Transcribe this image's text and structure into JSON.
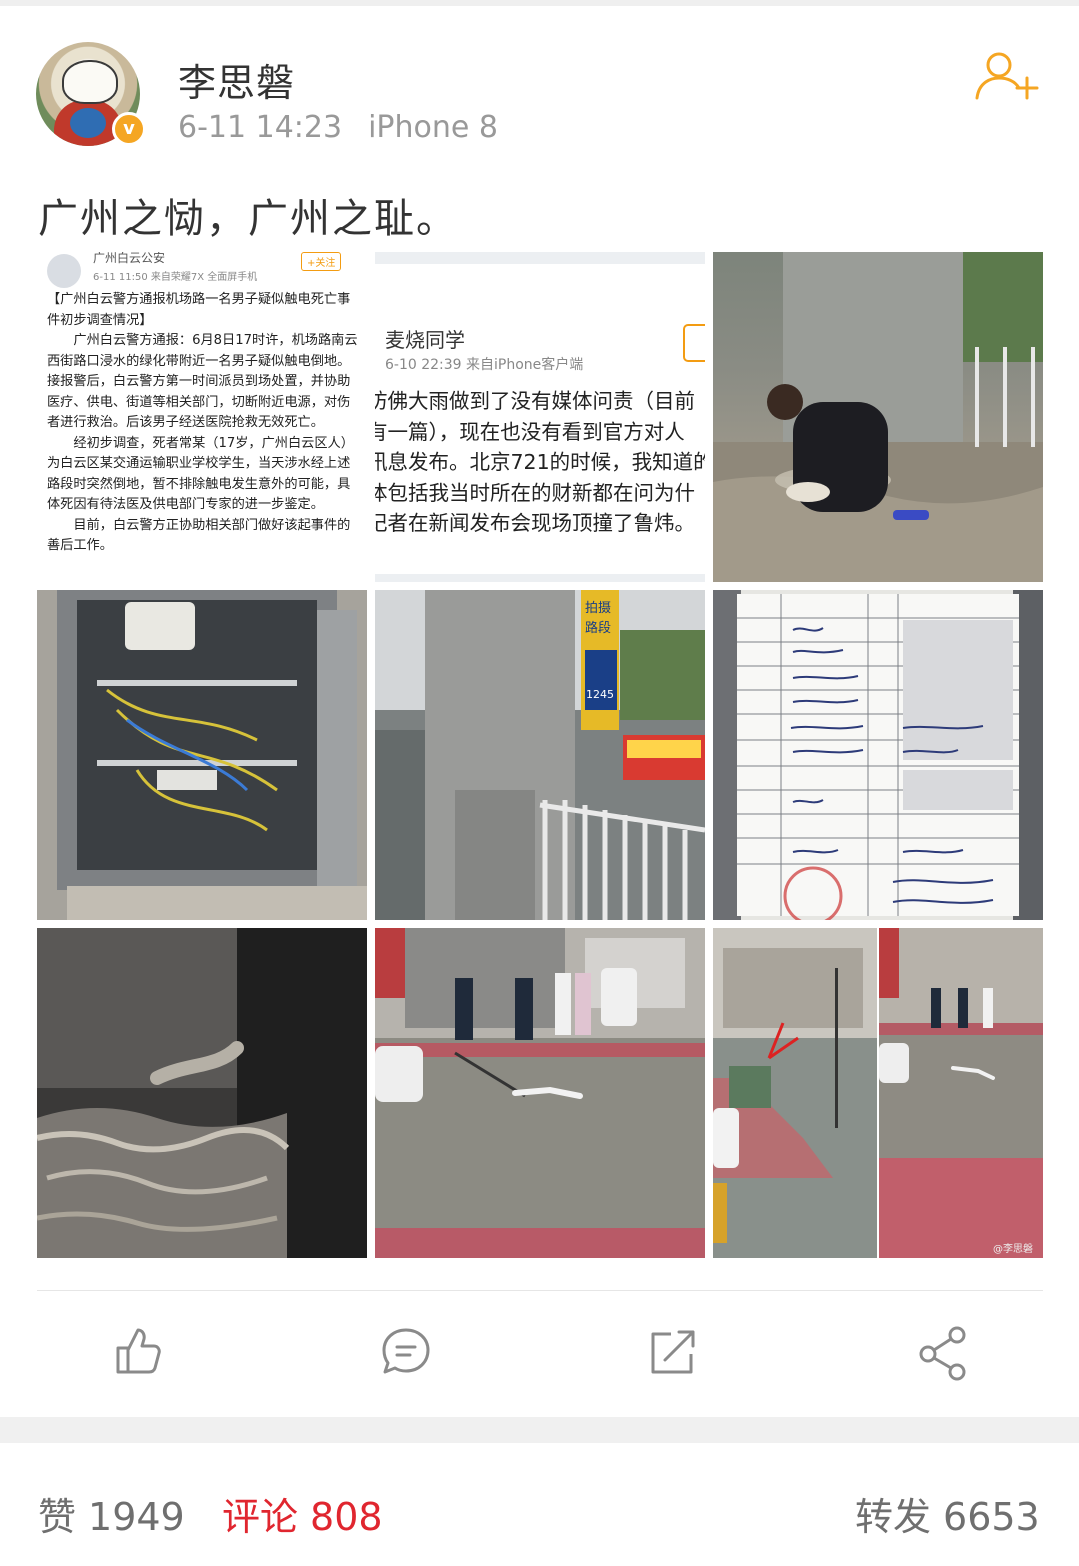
{
  "post": {
    "username": "李思磐",
    "time": "6-11 14:23",
    "device": "iPhone 8",
    "text": "广州之恸，广州之耻。"
  },
  "images": {
    "notice": {
      "account": "广州白云公安",
      "time": "6-11 11:50  来自荣耀7X 全面屏手机",
      "follow": "+关注",
      "title": "【广州白云警方通报机场路一名男子疑似触电死亡事件初步调查情况】",
      "p1": "广州白云警方通报：6月8日17时许，机场路南云西街路口浸水的绿化带附近一名男子疑似触电倒地。接报警后，白云警方第一时间派员到场处置，并协助医疗、供电、街道等相关部门，切断附近电源，对伤者进行救治。后该男子经送医院抢救无效死亡。",
      "p2": "经初步调查，死者常某（17岁，广州白云区人）为白云区某交通运输职业学校学生，当天涉水经上述路段时突然倒地，暂不排除触电发生意外的可能，具体死因有待法医及供电部门专家的进一步鉴定。",
      "p3": "目前，白云警方正协助相关部门做好该起事件的善后工作。"
    },
    "screenshot": {
      "name": "麦烧同学",
      "time": "6-10 22:39  来自iPhone客户端",
      "lines": [
        "彷佛大雨做到了没有媒体问责（目前",
        "有一篇），现在也没有看到官方对人",
        "讯息发布。北京721的时候，我知道的",
        "体包括我当时所在的财新都在问为什",
        "记者在新闻发布会现场顶撞了鲁炜。"
      ]
    },
    "street_sign": {
      "line1": "拍摄",
      "line2": "路段",
      "bus": "1245"
    },
    "form": {
      "labels": [
        "姓名",
        "国家或地区",
        "身份证件类别",
        "户籍地址",
        "常住地址",
        "出生日期",
        "死亡地点",
        "家属姓名",
        "与死者关系",
        "家庭住址或单位",
        "医师/法医签名",
        "签发机构"
      ],
      "values": [
        "男",
        "汉",
        "中国",
        "16岁",
        "身份证",
        "广州市白云区",
        "广州市白云区",
        "2001年10月18日",
        "2018年6月8日",
        "电击伤",
        "父子",
        "殷蝉元",
        "冷藏十五天 ，同期按殡葬规定处理"
      ]
    },
    "watermark": "@李思磐"
  },
  "actions": {
    "like_icon": "thumbs-up-icon",
    "comment_icon": "comment-icon",
    "repost_icon": "repost-icon",
    "share_icon": "share-icon"
  },
  "stats": {
    "likes_label": "赞",
    "likes": "1949",
    "comments_label": "评论",
    "comments": "808",
    "reposts_label": "转发",
    "reposts": "6653"
  },
  "colors": {
    "accent": "#f5a623",
    "active": "#e0262f"
  }
}
